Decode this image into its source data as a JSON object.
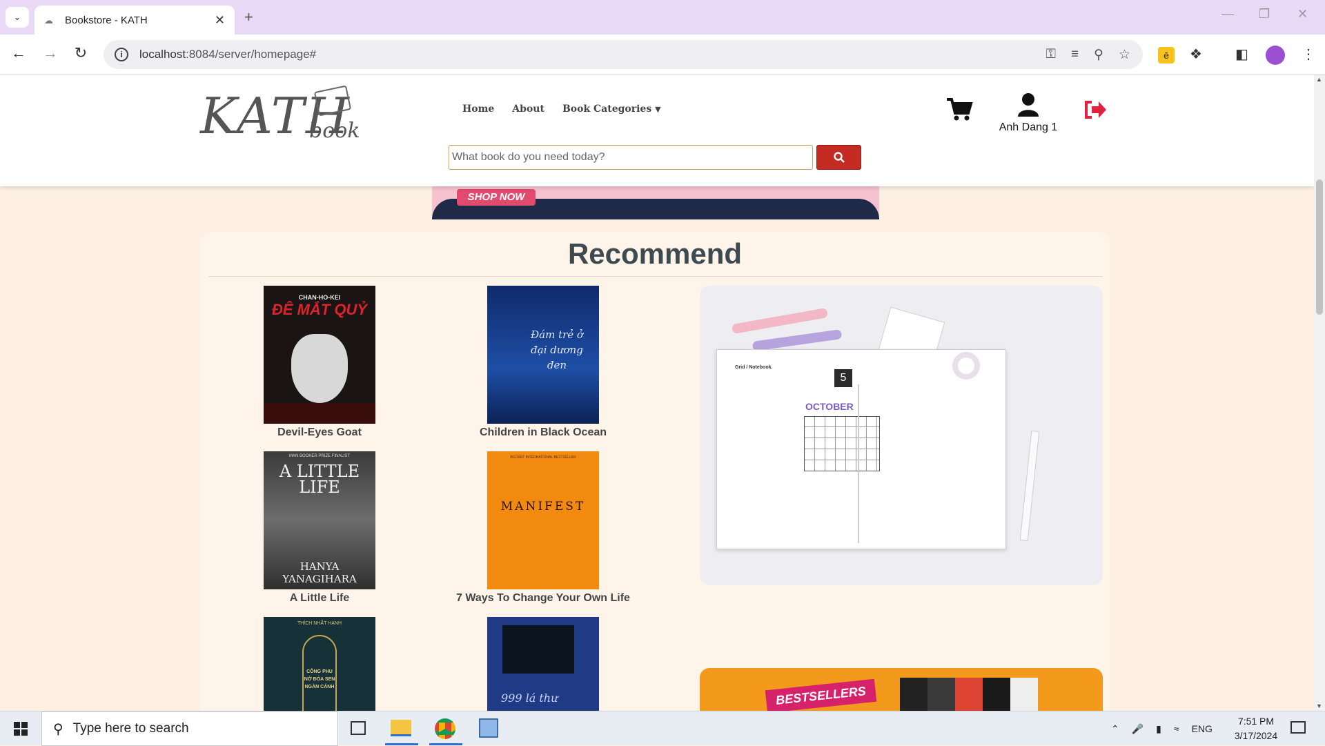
{
  "browser": {
    "tab_title": "Bookstore - KATH",
    "url_host": "localhost",
    "url_path": ":8084/server/homepage#"
  },
  "site": {
    "logo_main": "KATH",
    "logo_sub": "book",
    "nav": {
      "home": "Home",
      "about": "About",
      "categories": "Book Categories"
    },
    "search_placeholder": "What book do you need today?",
    "user_name": "Anh Dang 1"
  },
  "banner": {
    "cta": "SHOP NOW"
  },
  "recommend": {
    "title": "Recommend",
    "books": [
      {
        "title": "Devil-Eyes Goat",
        "cover_text": "CHAN-HO-KEI",
        "cover_title": "ĐÊ MẮT QUỶ"
      },
      {
        "title": "Children in Black Ocean",
        "cover_text": "Đám trẻ ở đại dương đen"
      },
      {
        "title": "A Little Life",
        "cover_top": "MAN BOOKER PRIZE FINALIST",
        "cover_title": "A LITTLE LIFE",
        "cover_author": "HANYA YANAGIHARA"
      },
      {
        "title": "7 Ways To Change Your Own Life",
        "cover_top": "INSTANT INTERNATIONAL BESTSELLER",
        "cover_title": "MANIFEST"
      },
      {
        "title": "",
        "cover_top": "THÍCH NHẤT HẠNH",
        "cover_title": "CÔNG PHU NỞ ĐÓA SEN NGÀN CÁNH"
      },
      {
        "title": "",
        "cover_title": "999 lá thư"
      }
    ],
    "promo_bestseller": "BESTSELLERS",
    "journal_text": {
      "month": "OCTOBER",
      "day": "5",
      "grid": "Grid / Notebook."
    }
  },
  "taskbar": {
    "search_placeholder": "Type here to search",
    "lang": "ENG",
    "time": "7:51 PM",
    "date": "3/17/2024"
  },
  "colors": {
    "accent_red": "#c42b22",
    "page_bg": "#fdf0e3",
    "panel_bg": "#fff4ea"
  }
}
